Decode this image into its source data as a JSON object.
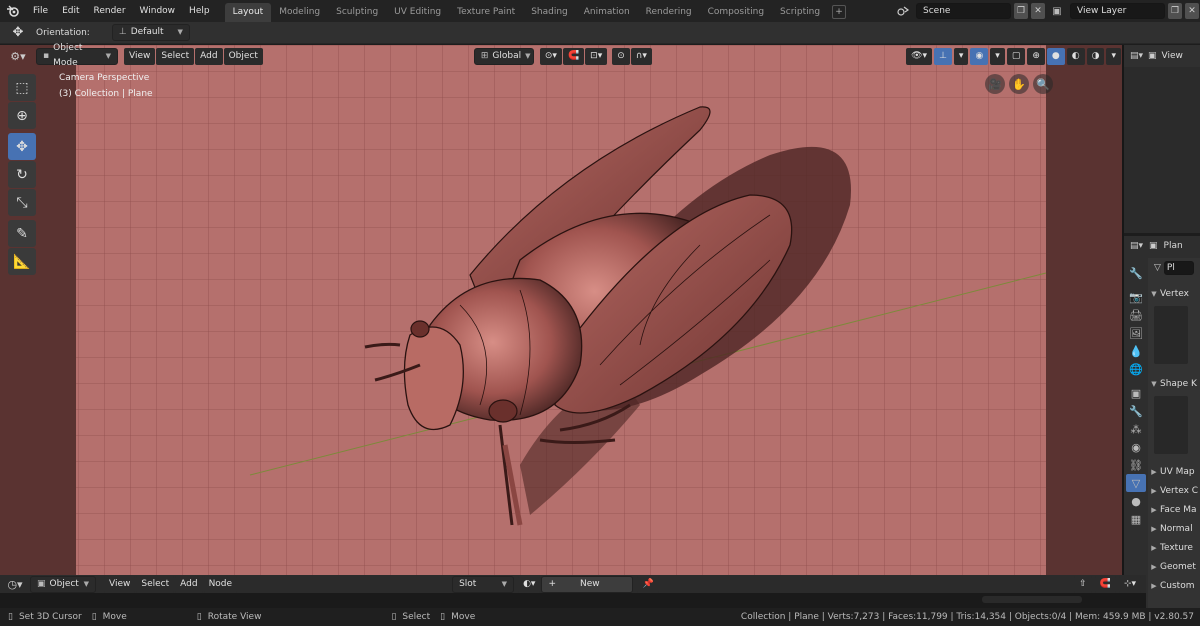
{
  "top_menu": {
    "items": [
      "File",
      "Edit",
      "Render",
      "Window",
      "Help"
    ]
  },
  "workspaces": {
    "tabs": [
      "Layout",
      "Modeling",
      "Sculpting",
      "UV Editing",
      "Texture Paint",
      "Shading",
      "Animation",
      "Rendering",
      "Compositing",
      "Scripting"
    ],
    "active": "Layout",
    "add": "+"
  },
  "scene": {
    "name": "Scene"
  },
  "view_layer": {
    "name": "View Layer"
  },
  "tool_settings": {
    "orientation_label": "Orientation:",
    "orientation_value": "Default"
  },
  "viewport_header": {
    "mode": "Object Mode",
    "menus": [
      "View",
      "Select",
      "Add",
      "Object"
    ],
    "transform": "Global"
  },
  "viewport_overlay": {
    "line1": "Camera Perspective",
    "line2": "(3) Collection | Plane"
  },
  "timeline": {
    "mode": "Object",
    "menus": [
      "View",
      "Select",
      "Add",
      "Node"
    ],
    "slot": "Slot",
    "new_label": "New",
    "new_plus": "+"
  },
  "status_bar": {
    "actions": [
      "Set 3D Cursor",
      "Move",
      "Rotate View",
      "Select",
      "Move"
    ],
    "stats": "Collection | Plane | Verts:7,273 | Faces:11,799 | Tris:14,354 | Objects:0/4 | Mem: 459.9 MB | v2.80.57"
  },
  "outliner": {
    "view_label": "View"
  },
  "properties": {
    "header_label": "Plan",
    "object_label": "Pl",
    "sections": [
      "Vertex",
      "Shape K",
      "UV Map",
      "Vertex C",
      "Face Ma",
      "Normal",
      "Texture",
      "Geomet",
      "Custom"
    ]
  },
  "colors": {
    "accent": "#4772b3",
    "viewport_floor": "#b86c69",
    "active_tool": "#4772b3"
  }
}
